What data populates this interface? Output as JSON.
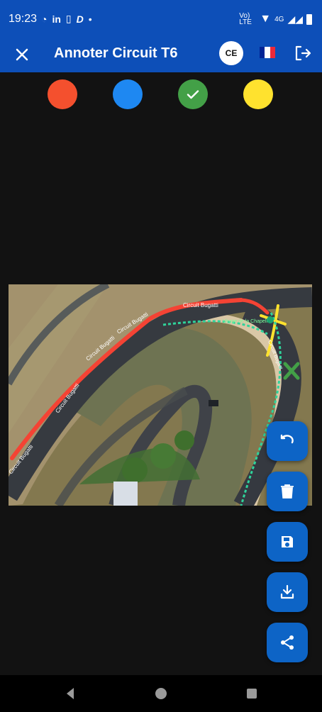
{
  "status_bar": {
    "time": "19:23",
    "left_icons": [
      "whatsapp-icon",
      "linkedin-icon",
      "phone-icon",
      "d-icon"
    ],
    "dot": "•",
    "network_label": "Vo) LTE",
    "cellular_label": "4G",
    "icons": [
      "wifi-icon",
      "signal-icon",
      "battery-icon"
    ]
  },
  "app_bar": {
    "title": "Annoter Circuit T6",
    "avatar_initials": "CE",
    "language_flag": "fr-flag-icon",
    "close_icon": "close-icon",
    "logout_icon": "logout-icon"
  },
  "palette": {
    "colors": [
      {
        "name": "red",
        "hex": "#f4502e",
        "selected": false
      },
      {
        "name": "blue",
        "hex": "#1e88f2",
        "selected": false
      },
      {
        "name": "green",
        "hex": "#43a047",
        "selected": true
      },
      {
        "name": "yellow",
        "hex": "#ffe22e",
        "selected": false
      }
    ]
  },
  "image": {
    "labels": [
      "Circuit Bugatti",
      "Circuit Bugatti",
      "Circuit Bugatti",
      "Circuit Bugatti",
      "Circuit Bugatti",
      "Virage de la Chapelle",
      "Circuit Bugatti"
    ]
  },
  "actions": [
    {
      "name": "undo",
      "icon": "undo-icon"
    },
    {
      "name": "delete",
      "icon": "trash-icon"
    },
    {
      "name": "save",
      "icon": "save-icon"
    },
    {
      "name": "download",
      "icon": "download-icon"
    },
    {
      "name": "share",
      "icon": "share-icon"
    }
  ],
  "navigation": [
    "back-icon",
    "home-icon",
    "recents-icon"
  ],
  "colors": {
    "app_bar": "#0d4fb8",
    "fab": "#0d64c6",
    "background": "#121212"
  }
}
